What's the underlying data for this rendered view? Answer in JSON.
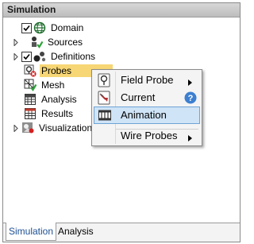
{
  "panel": {
    "title": "Simulation"
  },
  "tree": {
    "items": [
      {
        "label": "Domain",
        "checked": true,
        "icon": "globe-icon"
      },
      {
        "label": "Sources",
        "icon": "sources-icon"
      },
      {
        "label": "Definitions",
        "checked": true,
        "icon": "definitions-icon"
      },
      {
        "label": "Probes",
        "icon": "probes-icon",
        "selected": true
      },
      {
        "label": "Mesh",
        "icon": "mesh-icon"
      },
      {
        "label": "Analysis",
        "icon": "analysis-icon"
      },
      {
        "label": "Results",
        "icon": "results-icon"
      },
      {
        "label": "Visualization",
        "icon": "visualization-icon"
      }
    ]
  },
  "context_menu": {
    "items": [
      {
        "label": "Field Probe",
        "icon": "field-probe-icon",
        "submenu": true
      },
      {
        "label": "Current",
        "icon": "current-icon",
        "help": true
      },
      {
        "label": "Animation",
        "icon": "animation-icon",
        "highlighted": true
      },
      {
        "label": "Wire Probes",
        "submenu": true
      }
    ]
  },
  "tabs": {
    "items": [
      {
        "label": "Simulation",
        "active": true
      },
      {
        "label": "Analysis"
      }
    ]
  },
  "colors": {
    "selection": "#f7d675",
    "menu_highlight": "#cfe4f7",
    "menu_highlight_border": "#6fa3d6",
    "active_tab_text": "#1d4f91"
  }
}
